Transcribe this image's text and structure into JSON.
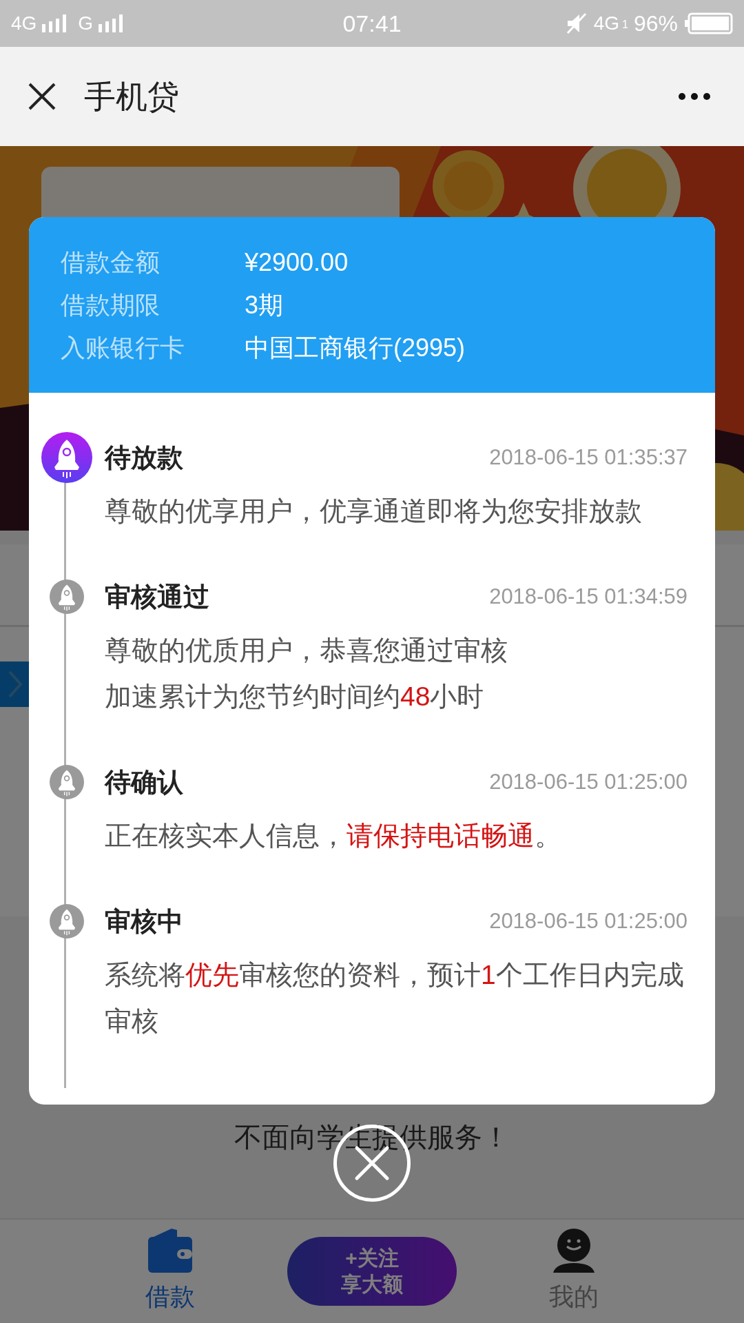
{
  "status_bar": {
    "carrier_1": "4G",
    "carrier_2": "G",
    "time": "07:41",
    "network": "4G",
    "sim_index": "1",
    "battery": "96%"
  },
  "header": {
    "title": "手机贷"
  },
  "background": {
    "notice": "不面向学生提供服务！"
  },
  "loan_summary": [
    {
      "label": "借款金额",
      "value": "¥2900.00"
    },
    {
      "label": "借款期限",
      "value": "3期"
    },
    {
      "label": "入账银行卡",
      "value": "中国工商银行(2995)"
    }
  ],
  "timeline": [
    {
      "title": "待放款",
      "time": "2018-06-15 01:35:37",
      "active": true,
      "lines": [
        [
          {
            "text": "尊敬的优享用户，优享通道即将为您安排放款",
            "highlight": false
          }
        ]
      ]
    },
    {
      "title": "审核通过",
      "time": "2018-06-15 01:34:59",
      "active": false,
      "lines": [
        [
          {
            "text": "尊敬的优质用户，恭喜您通过审核",
            "highlight": false
          }
        ],
        [
          {
            "text": "加速累计为您节约时间约",
            "highlight": false
          },
          {
            "text": "48",
            "highlight": true
          },
          {
            "text": "小时",
            "highlight": false
          }
        ]
      ]
    },
    {
      "title": "待确认",
      "time": "2018-06-15 01:25:00",
      "active": false,
      "lines": [
        [
          {
            "text": "正在核实本人信息，",
            "highlight": false
          },
          {
            "text": "请保持电话畅通",
            "highlight": true
          },
          {
            "text": "。",
            "highlight": false
          }
        ]
      ]
    },
    {
      "title": "审核中",
      "time": "2018-06-15 01:25:00",
      "active": false,
      "lines": [
        [
          {
            "text": "系统将",
            "highlight": false
          },
          {
            "text": "优先",
            "highlight": true
          },
          {
            "text": "审核您的资料，预计",
            "highlight": false
          },
          {
            "text": "1",
            "highlight": true
          },
          {
            "text": "个工作日内完成审核",
            "highlight": false
          }
        ]
      ]
    }
  ],
  "bottom_nav": [
    {
      "kind": "wallet",
      "label": "借款",
      "selected": true
    },
    {
      "kind": "promo",
      "lines": [
        "+关注",
        "享大额"
      ]
    },
    {
      "kind": "profile",
      "label": "我的",
      "selected": false
    }
  ]
}
